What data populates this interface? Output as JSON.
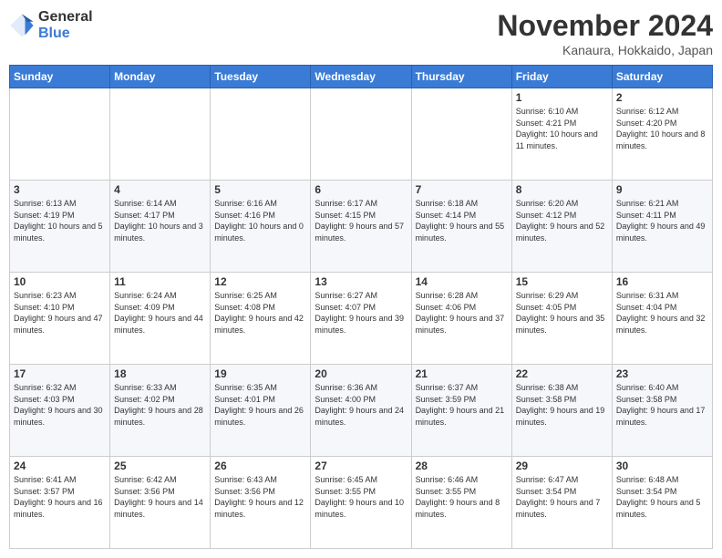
{
  "logo": {
    "general": "General",
    "blue": "Blue"
  },
  "title": "November 2024",
  "location": "Kanaura, Hokkaido, Japan",
  "weekdays": [
    "Sunday",
    "Monday",
    "Tuesday",
    "Wednesday",
    "Thursday",
    "Friday",
    "Saturday"
  ],
  "weeks": [
    [
      {
        "day": "",
        "info": ""
      },
      {
        "day": "",
        "info": ""
      },
      {
        "day": "",
        "info": ""
      },
      {
        "day": "",
        "info": ""
      },
      {
        "day": "",
        "info": ""
      },
      {
        "day": "1",
        "info": "Sunrise: 6:10 AM\nSunset: 4:21 PM\nDaylight: 10 hours and 11 minutes."
      },
      {
        "day": "2",
        "info": "Sunrise: 6:12 AM\nSunset: 4:20 PM\nDaylight: 10 hours and 8 minutes."
      }
    ],
    [
      {
        "day": "3",
        "info": "Sunrise: 6:13 AM\nSunset: 4:19 PM\nDaylight: 10 hours and 5 minutes."
      },
      {
        "day": "4",
        "info": "Sunrise: 6:14 AM\nSunset: 4:17 PM\nDaylight: 10 hours and 3 minutes."
      },
      {
        "day": "5",
        "info": "Sunrise: 6:16 AM\nSunset: 4:16 PM\nDaylight: 10 hours and 0 minutes."
      },
      {
        "day": "6",
        "info": "Sunrise: 6:17 AM\nSunset: 4:15 PM\nDaylight: 9 hours and 57 minutes."
      },
      {
        "day": "7",
        "info": "Sunrise: 6:18 AM\nSunset: 4:14 PM\nDaylight: 9 hours and 55 minutes."
      },
      {
        "day": "8",
        "info": "Sunrise: 6:20 AM\nSunset: 4:12 PM\nDaylight: 9 hours and 52 minutes."
      },
      {
        "day": "9",
        "info": "Sunrise: 6:21 AM\nSunset: 4:11 PM\nDaylight: 9 hours and 49 minutes."
      }
    ],
    [
      {
        "day": "10",
        "info": "Sunrise: 6:23 AM\nSunset: 4:10 PM\nDaylight: 9 hours and 47 minutes."
      },
      {
        "day": "11",
        "info": "Sunrise: 6:24 AM\nSunset: 4:09 PM\nDaylight: 9 hours and 44 minutes."
      },
      {
        "day": "12",
        "info": "Sunrise: 6:25 AM\nSunset: 4:08 PM\nDaylight: 9 hours and 42 minutes."
      },
      {
        "day": "13",
        "info": "Sunrise: 6:27 AM\nSunset: 4:07 PM\nDaylight: 9 hours and 39 minutes."
      },
      {
        "day": "14",
        "info": "Sunrise: 6:28 AM\nSunset: 4:06 PM\nDaylight: 9 hours and 37 minutes."
      },
      {
        "day": "15",
        "info": "Sunrise: 6:29 AM\nSunset: 4:05 PM\nDaylight: 9 hours and 35 minutes."
      },
      {
        "day": "16",
        "info": "Sunrise: 6:31 AM\nSunset: 4:04 PM\nDaylight: 9 hours and 32 minutes."
      }
    ],
    [
      {
        "day": "17",
        "info": "Sunrise: 6:32 AM\nSunset: 4:03 PM\nDaylight: 9 hours and 30 minutes."
      },
      {
        "day": "18",
        "info": "Sunrise: 6:33 AM\nSunset: 4:02 PM\nDaylight: 9 hours and 28 minutes."
      },
      {
        "day": "19",
        "info": "Sunrise: 6:35 AM\nSunset: 4:01 PM\nDaylight: 9 hours and 26 minutes."
      },
      {
        "day": "20",
        "info": "Sunrise: 6:36 AM\nSunset: 4:00 PM\nDaylight: 9 hours and 24 minutes."
      },
      {
        "day": "21",
        "info": "Sunrise: 6:37 AM\nSunset: 3:59 PM\nDaylight: 9 hours and 21 minutes."
      },
      {
        "day": "22",
        "info": "Sunrise: 6:38 AM\nSunset: 3:58 PM\nDaylight: 9 hours and 19 minutes."
      },
      {
        "day": "23",
        "info": "Sunrise: 6:40 AM\nSunset: 3:58 PM\nDaylight: 9 hours and 17 minutes."
      }
    ],
    [
      {
        "day": "24",
        "info": "Sunrise: 6:41 AM\nSunset: 3:57 PM\nDaylight: 9 hours and 16 minutes."
      },
      {
        "day": "25",
        "info": "Sunrise: 6:42 AM\nSunset: 3:56 PM\nDaylight: 9 hours and 14 minutes."
      },
      {
        "day": "26",
        "info": "Sunrise: 6:43 AM\nSunset: 3:56 PM\nDaylight: 9 hours and 12 minutes."
      },
      {
        "day": "27",
        "info": "Sunrise: 6:45 AM\nSunset: 3:55 PM\nDaylight: 9 hours and 10 minutes."
      },
      {
        "day": "28",
        "info": "Sunrise: 6:46 AM\nSunset: 3:55 PM\nDaylight: 9 hours and 8 minutes."
      },
      {
        "day": "29",
        "info": "Sunrise: 6:47 AM\nSunset: 3:54 PM\nDaylight: 9 hours and 7 minutes."
      },
      {
        "day": "30",
        "info": "Sunrise: 6:48 AM\nSunset: 3:54 PM\nDaylight: 9 hours and 5 minutes."
      }
    ]
  ]
}
